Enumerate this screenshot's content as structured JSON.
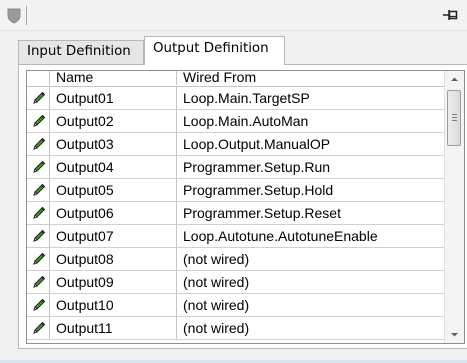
{
  "toolbar": {
    "shield_icon": "shield-icon",
    "pin_icon": "pin-icon"
  },
  "tabs": [
    {
      "label": "Input Definition",
      "active": false
    },
    {
      "label": "Output Definition",
      "active": true
    }
  ],
  "table": {
    "columns": [
      "Name",
      "Wired From"
    ],
    "rows": [
      {
        "name": "Output01",
        "wired_from": "Loop.Main.TargetSP"
      },
      {
        "name": "Output02",
        "wired_from": "Loop.Main.AutoMan"
      },
      {
        "name": "Output03",
        "wired_from": "Loop.Output.ManualOP"
      },
      {
        "name": "Output04",
        "wired_from": "Programmer.Setup.Run"
      },
      {
        "name": "Output05",
        "wired_from": "Programmer.Setup.Hold"
      },
      {
        "name": "Output06",
        "wired_from": "Programmer.Setup.Reset"
      },
      {
        "name": "Output07",
        "wired_from": "Loop.Autotune.AutotuneEnable"
      },
      {
        "name": "Output08",
        "wired_from": "(not wired)"
      },
      {
        "name": "Output09",
        "wired_from": "(not wired)"
      },
      {
        "name": "Output10",
        "wired_from": "(not wired)"
      },
      {
        "name": "Output11",
        "wired_from": "(not wired)"
      }
    ],
    "row_icon": "pencil-icon"
  },
  "colors": {
    "pencil_green": "#3aa41c",
    "pencil_outline": "#1d1d1d",
    "frame_border": "#b7b7b7"
  }
}
